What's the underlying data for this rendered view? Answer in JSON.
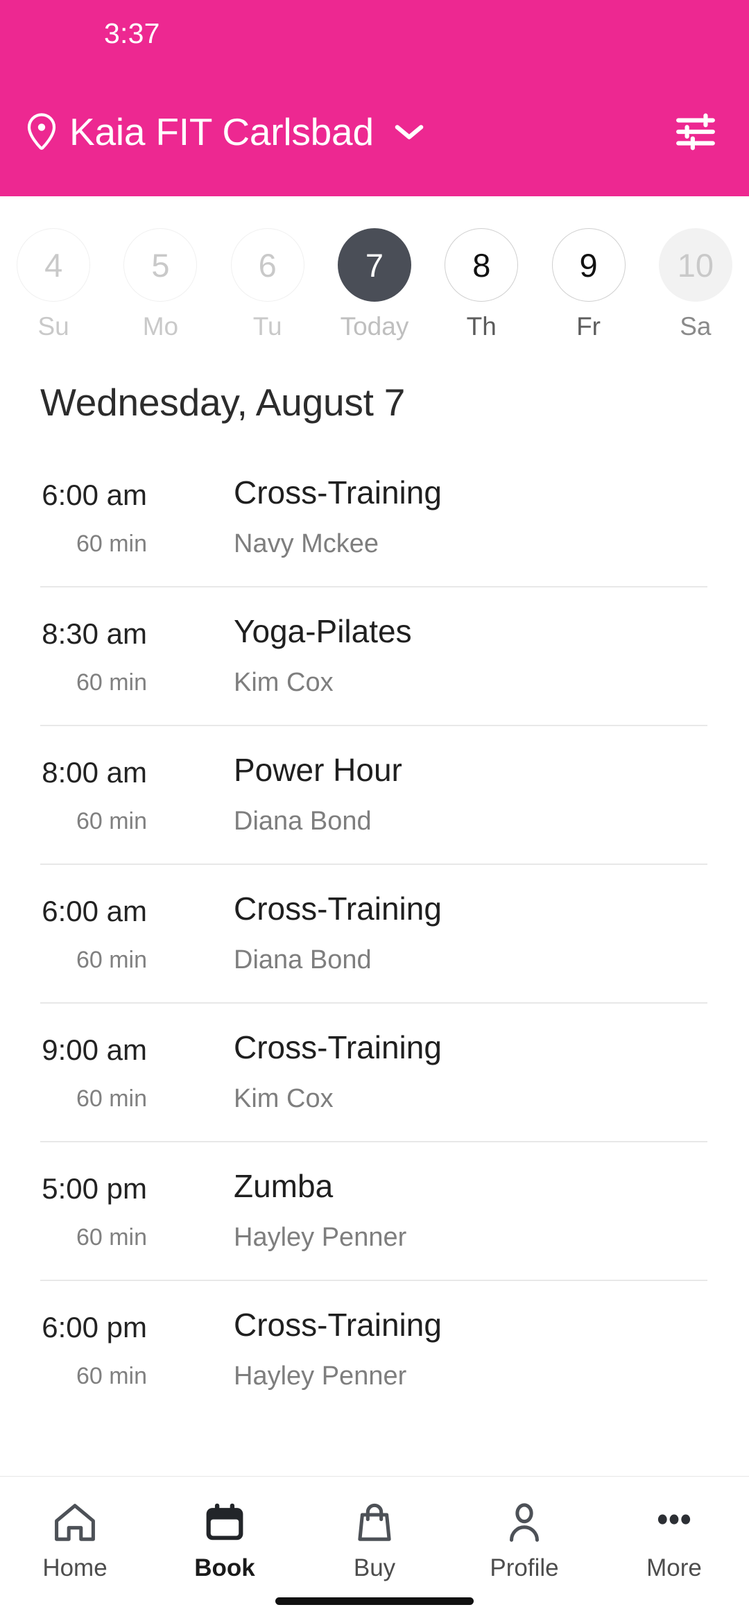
{
  "status_bar": {
    "time": "3:37"
  },
  "header": {
    "location_name": "Kaia FIT Carlsbad",
    "pin_icon": "location-pin-icon",
    "chevron_icon": "chevron-down-icon",
    "filter_icon": "tune-sliders-icon",
    "background_color": "#ED2891",
    "text_color": "#FFFFFF"
  },
  "date_strip": {
    "days": [
      {
        "number": "4",
        "label": "Su",
        "state": "past"
      },
      {
        "number": "5",
        "label": "Mo",
        "state": "past"
      },
      {
        "number": "6",
        "label": "Tu",
        "state": "past"
      },
      {
        "number": "7",
        "label": "Today",
        "state": "today"
      },
      {
        "number": "8",
        "label": "Th",
        "state": "future"
      },
      {
        "number": "9",
        "label": "Fr",
        "state": "future"
      },
      {
        "number": "10",
        "label": "Sa",
        "state": "muted"
      }
    ],
    "selected_color": "#4A4E57"
  },
  "date_heading": "Wednesday, August 7",
  "classes": [
    {
      "time": "6:00 am",
      "duration": "60 min",
      "name": "Cross-Training",
      "instructor": "Navy Mckee"
    },
    {
      "time": "8:30 am",
      "duration": "60 min",
      "name": "Yoga-Pilates",
      "instructor": "Kim Cox"
    },
    {
      "time": "8:00 am",
      "duration": "60 min",
      "name": "Power Hour",
      "instructor": "Diana Bond"
    },
    {
      "time": "6:00 am",
      "duration": "60 min",
      "name": "Cross-Training",
      "instructor": "Diana Bond"
    },
    {
      "time": "9:00 am",
      "duration": "60 min",
      "name": "Cross-Training",
      "instructor": "Kim Cox"
    },
    {
      "time": "5:00 pm",
      "duration": "60 min",
      "name": "Zumba",
      "instructor": "Hayley Penner"
    },
    {
      "time": "6:00 pm",
      "duration": "60 min",
      "name": "Cross-Training",
      "instructor": "Hayley Penner"
    }
  ],
  "bottom_nav": {
    "items": [
      {
        "label": "Home",
        "icon": "home-icon",
        "active": false
      },
      {
        "label": "Book",
        "icon": "calendar-icon",
        "active": true
      },
      {
        "label": "Buy",
        "icon": "shopping-bag-icon",
        "active": false
      },
      {
        "label": "Profile",
        "icon": "person-icon",
        "active": false
      },
      {
        "label": "More",
        "icon": "ellipsis-icon",
        "active": false
      }
    ]
  }
}
